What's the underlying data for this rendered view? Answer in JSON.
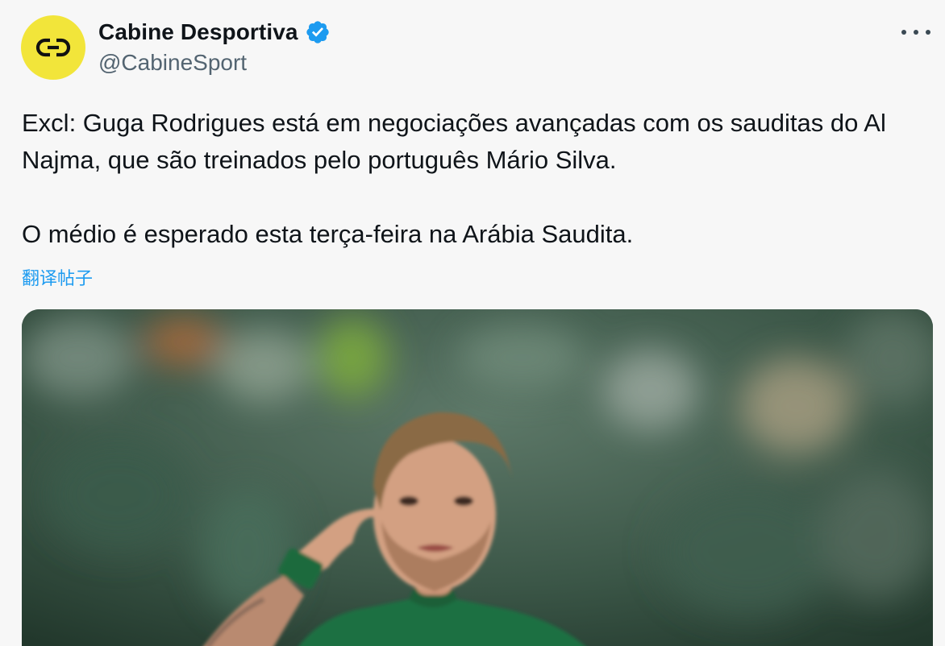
{
  "author": {
    "display_name": "Cabine Desportiva",
    "handle": "@CabineSport",
    "verified": true,
    "avatar_icon": "cabine-logo-icon",
    "avatar_color": "#f2e53a"
  },
  "tweet": {
    "paragraph_1": "Excl: Guga Rodrigues está em negociações avançadas com os sauditas do Al Najma, que são treinados pelo português Mário Silva.",
    "paragraph_2": "O médio é esperado esta terça-feira na Arábia Saudita.",
    "translate_label": "翻译帖子"
  },
  "icons": {
    "verified": "verified-badge-icon",
    "more": "more-options-icon"
  },
  "colors": {
    "link": "#1d9bf0",
    "verified": "#1d9bf0",
    "secondary_text": "#536471"
  }
}
